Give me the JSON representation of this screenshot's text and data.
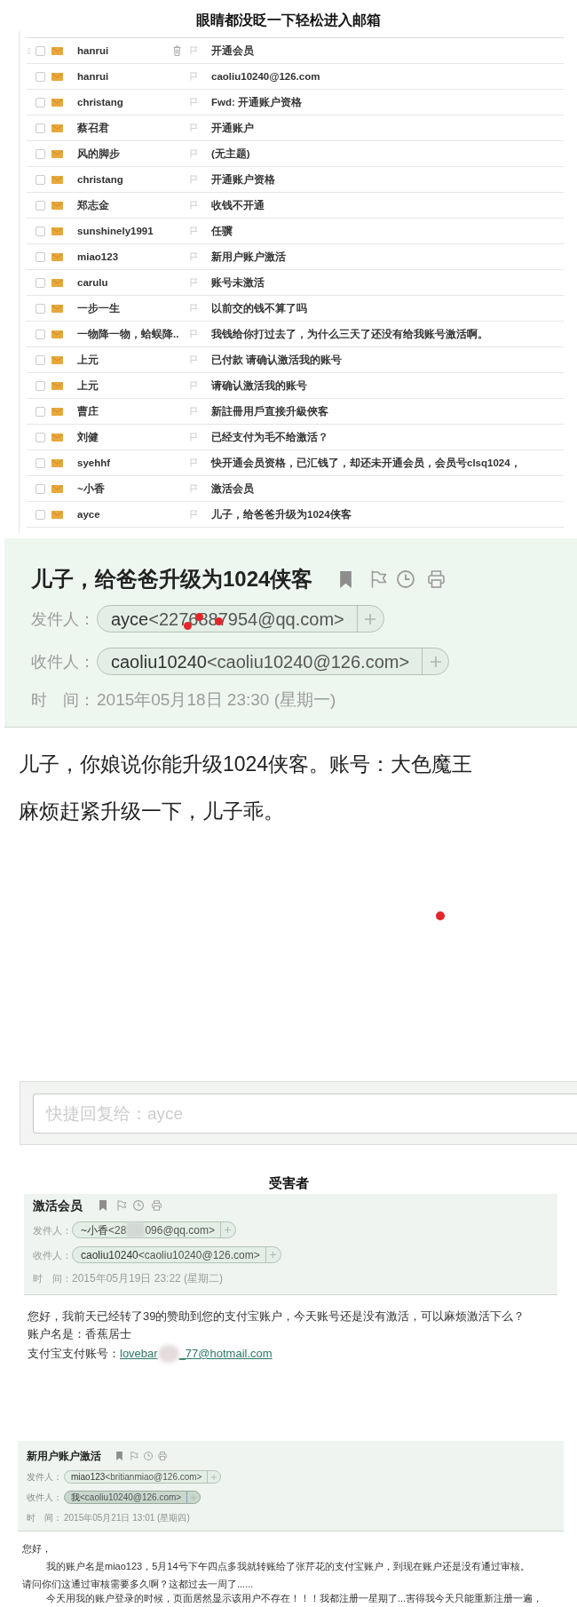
{
  "page_title": "眼睛都没眨一下轻松进入邮箱",
  "inbox": {
    "rows": [
      {
        "sender": "hanrui",
        "subject": "开通会员",
        "hovered": true,
        "checked": false
      },
      {
        "sender": "hanrui",
        "subject": "caoliu10240@126.com",
        "hovered": false,
        "checked": false
      },
      {
        "sender": "christang",
        "subject": "Fwd: 开通账户资格",
        "hovered": false,
        "checked": false
      },
      {
        "sender": "蔡召君",
        "subject": "开通账户",
        "hovered": false,
        "checked": false
      },
      {
        "sender": "风的脚步",
        "subject": "(无主题)",
        "hovered": false,
        "checked": false
      },
      {
        "sender": "christang",
        "subject": "开通账户资格",
        "hovered": false,
        "checked": false
      },
      {
        "sender": "郑志金",
        "subject": "收钱不开通",
        "hovered": false,
        "checked": false
      },
      {
        "sender": "sunshinely1991",
        "subject": "任骥",
        "hovered": false,
        "checked": false
      },
      {
        "sender": "miao123",
        "subject": "新用户账户激活",
        "hovered": false,
        "checked": false
      },
      {
        "sender": "carulu",
        "subject": "账号未激活",
        "hovered": false,
        "checked": false
      },
      {
        "sender": "一步一生",
        "subject": "以前交的钱不算了吗",
        "hovered": false,
        "checked": false
      },
      {
        "sender": "一物降一物，蛤蜈降..",
        "subject": "我钱给你打过去了，为什么三天了还没有给我账号激活啊。",
        "hovered": false,
        "checked": false
      },
      {
        "sender": "上元",
        "subject": "已付款 请确认激活我的账号",
        "hovered": false,
        "checked": false
      },
      {
        "sender": "上元",
        "subject": "请确认激活我的账号",
        "hovered": false,
        "checked": false
      },
      {
        "sender": "曹庄",
        "subject": "新註冊用戶直接升級俠客",
        "hovered": false,
        "checked": false
      },
      {
        "sender": "刘健",
        "subject": "已经支付为毛不给激活？",
        "hovered": false,
        "checked": false
      },
      {
        "sender": "syehhf",
        "subject": "快开通会员资格，已汇钱了，却还未开通会员，会员号clsq1024，",
        "hovered": false,
        "checked": false
      },
      {
        "sender": "~小香",
        "subject": "激活会员",
        "hovered": false,
        "checked": false
      },
      {
        "sender": "ayce",
        "subject": "儿子，给爸爸升级为1024侠客",
        "hovered": false,
        "checked": false
      }
    ]
  },
  "open_email": {
    "subject": "儿子，给爸爸升级为1024侠客",
    "from": {
      "label": "发件人：",
      "name": "ayce",
      "address_parts": [
        "<2276887954@qq.com>"
      ],
      "highlighted": false
    },
    "to": {
      "label": "收件人：",
      "name": "caoliu10240",
      "address_parts": [
        "<caoliu10240@126.com>"
      ],
      "highlighted": false
    },
    "time": {
      "label": "时　间：",
      "value": "2015年05月18日 23:30 (星期一)"
    },
    "body": [
      "儿子，你娘说你能升级1024侠客。账号：大色魔王",
      "麻烦赶紧升级一下，儿子乖。"
    ],
    "quick_reply": {
      "placeholder": "快捷回复给：ayce"
    }
  },
  "victims_heading": "受害者",
  "victim_emails": [
    {
      "subject": "激活会员",
      "from": {
        "label": "发件人：",
        "name": "~小香",
        "address_parts": [
          "<28",
          "096@qq.com>"
        ],
        "highlighted": false
      },
      "to": {
        "label": "收件人：",
        "name": "caoliu10240",
        "address_parts": [
          "<caoliu10240@126.com>"
        ],
        "highlighted": false
      },
      "time": {
        "label": "时　间：",
        "value": "2015年05月19日 23:22 (星期二)"
      },
      "body": [
        {
          "kind": "text",
          "text": "您好，我前天已经转了39的赞助到您的支付宝账户，今天账号还是没有激活，可以麻烦激活下么？"
        },
        {
          "kind": "text",
          "text": "账户名是：香蕉居士"
        },
        {
          "kind": "link",
          "label": "支付宝支付账号：",
          "link_parts": [
            "lovebar",
            "_77@hotmail.com"
          ]
        }
      ]
    },
    {
      "subject": "新用户账户激活",
      "from": {
        "label": "发件人：",
        "name": "miao123",
        "address_parts": [
          "<britianmiao@126.com>"
        ],
        "highlighted": false
      },
      "to": {
        "label": "收件人：",
        "name": "我",
        "address_parts": [
          "<caoliu10240@126.com>"
        ],
        "highlighted": true
      },
      "time": {
        "label": "时　间：",
        "value": "2015年05月21日 13:01 (星期四)"
      },
      "body": [
        {
          "kind": "text",
          "text": "您好，"
        },
        {
          "kind": "indented",
          "text": "我的账户名是miao123，5月14号下午四点多我就转账给了张芹花的支付宝账户，到现在账户还是没有通过审核。"
        },
        {
          "kind": "text",
          "text": "请问你们这通过审核需要多久啊？这都过去一周了......"
        },
        {
          "kind": "indented",
          "text": "今天用我的账户登录的时候，页面居然显示该用户不存在！！！我都注册一星期了...害得我今天只能重新注册一遍，"
        }
      ]
    }
  ]
}
